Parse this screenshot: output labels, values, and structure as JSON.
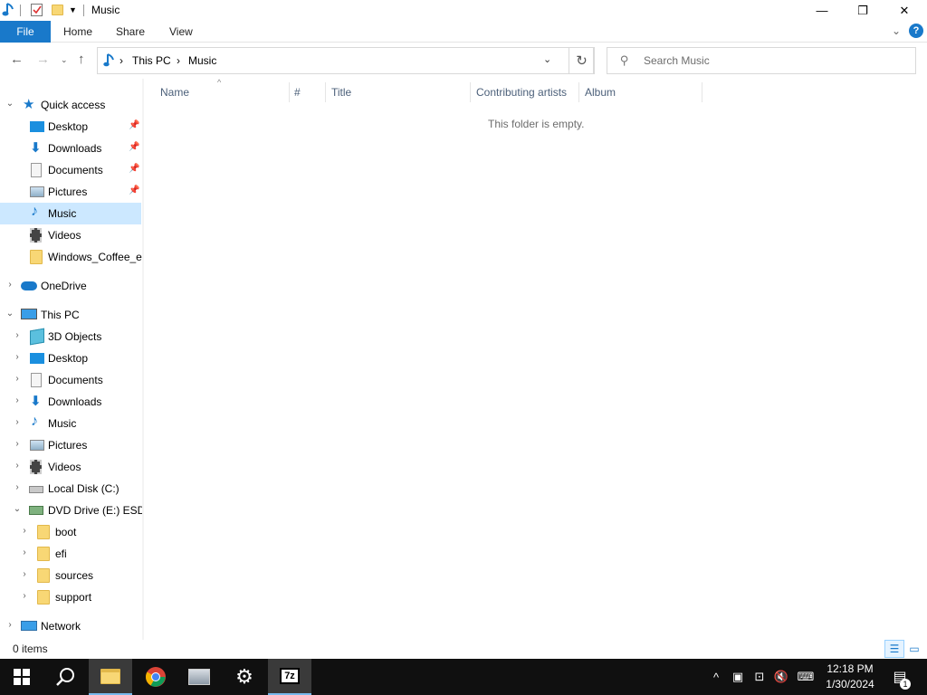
{
  "window": {
    "title": "Music",
    "minimize": "—",
    "restore": "❐",
    "close": "✕"
  },
  "ribbon": {
    "file": "File",
    "tabs": [
      "Home",
      "Share",
      "View"
    ],
    "help": "?"
  },
  "address": {
    "crumbs": [
      "This PC",
      "Music"
    ],
    "separator": "›"
  },
  "search": {
    "placeholder": "Search Music"
  },
  "nav": {
    "quick_access": "Quick access",
    "quick_items": [
      "Desktop",
      "Downloads",
      "Documents",
      "Pictures",
      "Music",
      "Videos",
      "Windows_Coffee_ed"
    ],
    "onedrive": "OneDrive",
    "this_pc": "This PC",
    "pc_items": [
      "3D Objects",
      "Desktop",
      "Documents",
      "Downloads",
      "Music",
      "Pictures",
      "Videos",
      "Local Disk (C:)",
      "DVD Drive (E:) ESD-I"
    ],
    "dvd_items": [
      "boot",
      "efi",
      "sources",
      "support"
    ],
    "network": "Network"
  },
  "columns": [
    "Name",
    "#",
    "Title",
    "Contributing artists",
    "Album"
  ],
  "content": {
    "empty_message": "This folder is empty."
  },
  "status": {
    "item_count": "0 items"
  },
  "taskbar": {
    "time": "12:18 PM",
    "date": "1/30/2024",
    "notification_count": "1"
  },
  "colors": {
    "accent": "#1979ca",
    "selection": "#cce8ff",
    "taskbar": "#101010"
  }
}
